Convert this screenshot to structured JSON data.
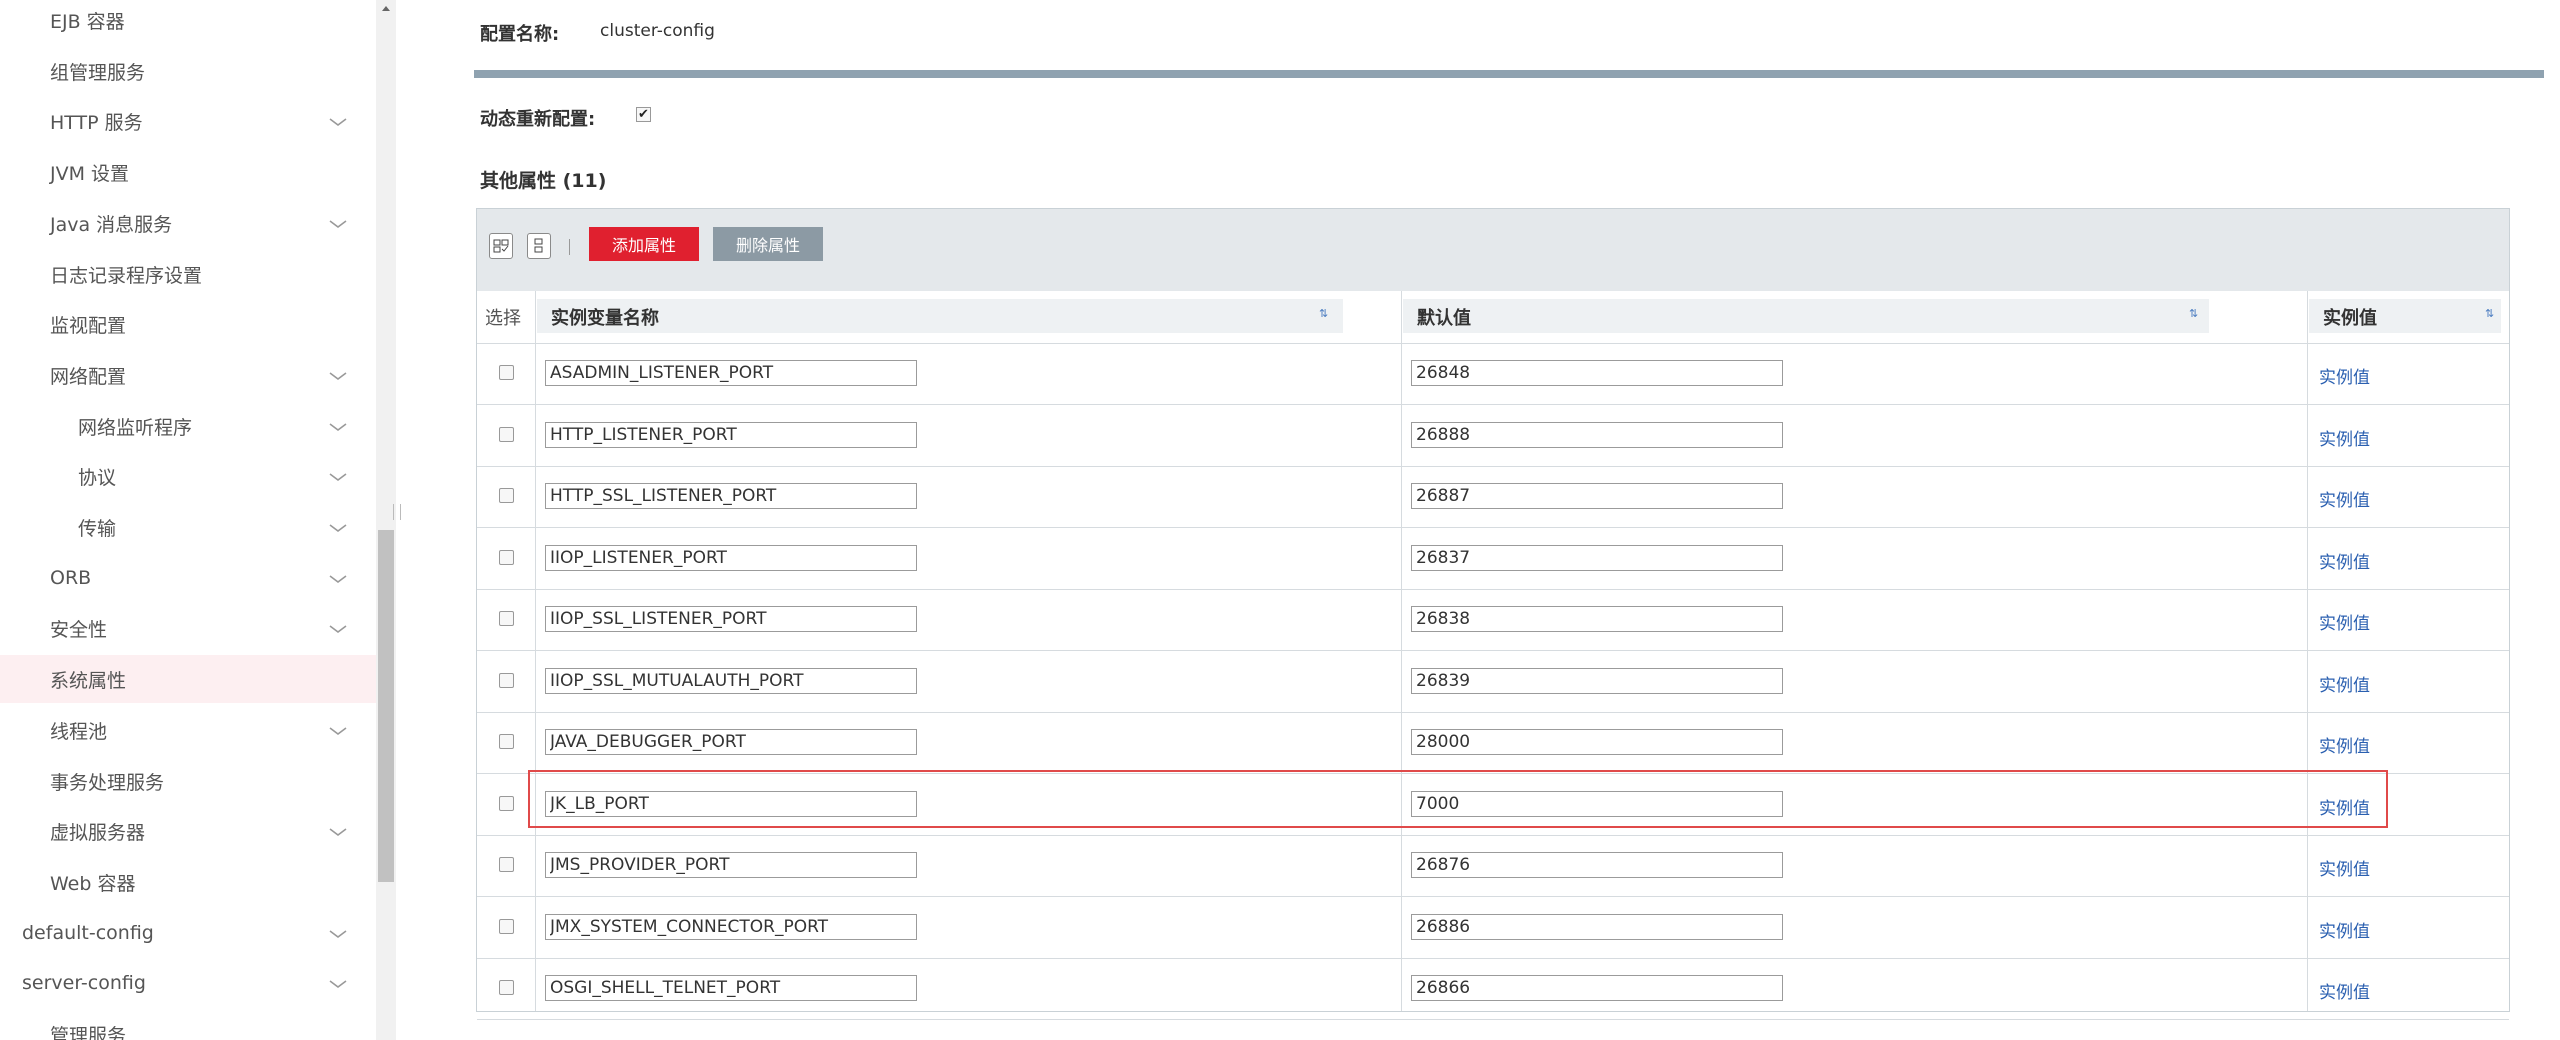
{
  "sidebar": {
    "items": [
      {
        "label": "EJB 容器",
        "indent": 1,
        "chevron": false,
        "active": false
      },
      {
        "label": "组管理服务",
        "indent": 1,
        "chevron": false,
        "active": false
      },
      {
        "label": "HTTP 服务",
        "indent": 1,
        "chevron": true,
        "active": false
      },
      {
        "label": "JVM 设置",
        "indent": 1,
        "chevron": false,
        "active": false
      },
      {
        "label": "Java 消息服务",
        "indent": 1,
        "chevron": true,
        "active": false
      },
      {
        "label": "日志记录程序设置",
        "indent": 1,
        "chevron": false,
        "active": false
      },
      {
        "label": "监视配置",
        "indent": 1,
        "chevron": false,
        "active": false
      },
      {
        "label": "网络配置",
        "indent": 1,
        "chevron": true,
        "active": false
      },
      {
        "label": "网络监听程序",
        "indent": 2,
        "chevron": true,
        "active": false
      },
      {
        "label": "协议",
        "indent": 2,
        "chevron": true,
        "active": false
      },
      {
        "label": "传输",
        "indent": 2,
        "chevron": true,
        "active": false
      },
      {
        "label": "ORB",
        "indent": 1,
        "chevron": true,
        "active": false
      },
      {
        "label": "安全性",
        "indent": 1,
        "chevron": true,
        "active": false
      },
      {
        "label": "系统属性",
        "indent": 1,
        "chevron": false,
        "active": true
      },
      {
        "label": "线程池",
        "indent": 1,
        "chevron": true,
        "active": false
      },
      {
        "label": "事务处理服务",
        "indent": 1,
        "chevron": false,
        "active": false
      },
      {
        "label": "虚拟服务器",
        "indent": 1,
        "chevron": true,
        "active": false
      },
      {
        "label": "Web 容器",
        "indent": 1,
        "chevron": false,
        "active": false
      },
      {
        "label": "default-config",
        "indent": 0,
        "chevron": true,
        "active": false
      },
      {
        "label": "server-config",
        "indent": 0,
        "chevron": true,
        "active": false
      },
      {
        "label": "管理服务",
        "indent": 1,
        "chevron": false,
        "active": false
      }
    ]
  },
  "main": {
    "config_name_label": "配置名称:",
    "config_name_value": "cluster-config",
    "dynamic_reconfig_label": "动态重新配置:",
    "dynamic_reconfig_checked": true,
    "properties_title": "其他属性 (11)",
    "toolbar": {
      "add_label": "添加属性",
      "delete_label": "删除属性"
    },
    "table": {
      "headers": {
        "select": "选择",
        "name": "实例变量名称",
        "default": "默认值",
        "instance": "实例值"
      },
      "rows": [
        {
          "name": "ASADMIN_LISTENER_PORT",
          "value": "26848",
          "link": "实例值"
        },
        {
          "name": "HTTP_LISTENER_PORT",
          "value": "26888",
          "link": "实例值"
        },
        {
          "name": "HTTP_SSL_LISTENER_PORT",
          "value": "26887",
          "link": "实例值"
        },
        {
          "name": "IIOP_LISTENER_PORT",
          "value": "26837",
          "link": "实例值"
        },
        {
          "name": "IIOP_SSL_LISTENER_PORT",
          "value": "26838",
          "link": "实例值"
        },
        {
          "name": "IIOP_SSL_MUTUALAUTH_PORT",
          "value": "26839",
          "link": "实例值"
        },
        {
          "name": "JAVA_DEBUGGER_PORT",
          "value": "28000",
          "link": "实例值"
        },
        {
          "name": "JK_LB_PORT",
          "value": "7000",
          "link": "实例值"
        },
        {
          "name": "JMS_PROVIDER_PORT",
          "value": "26876",
          "link": "实例值"
        },
        {
          "name": "JMX_SYSTEM_CONNECTOR_PORT",
          "value": "26886",
          "link": "实例值"
        },
        {
          "name": "OSGI_SHELL_TELNET_PORT",
          "value": "26866",
          "link": "实例值"
        }
      ]
    }
  },
  "colors": {
    "accent_red": "#e0202f",
    "delete_gray": "#8c9aa4",
    "active_bg": "#fdeff1",
    "link_blue": "#2a5fb0",
    "highlight_border": "#e04a4a"
  }
}
